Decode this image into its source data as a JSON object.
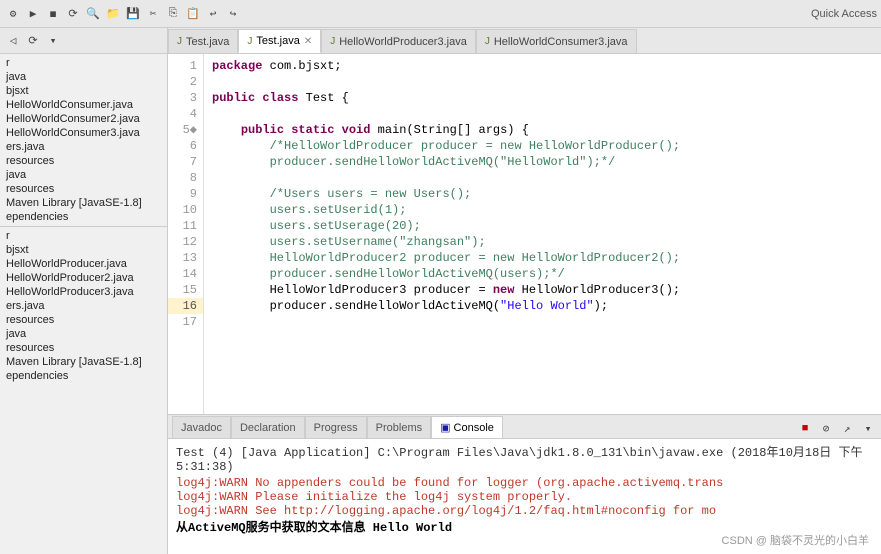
{
  "toolbar": {
    "quick_access_label": "Quick Access"
  },
  "sidebar": {
    "items": [
      {
        "label": "r"
      },
      {
        "label": "java"
      },
      {
        "label": "bjsxt"
      },
      {
        "label": "HelloWorldConsumer.java"
      },
      {
        "label": "HelloWorldConsumer2.java"
      },
      {
        "label": "HelloWorldConsumer3.java"
      },
      {
        "label": "ers.java"
      },
      {
        "label": "resources"
      },
      {
        "label": "java"
      },
      {
        "label": "resources"
      },
      {
        "label": "Maven Library [JavaSE-1.8]"
      },
      {
        "label": "ependencies"
      },
      {
        "label": ""
      },
      {
        "label": "r"
      },
      {
        "label": "bjsxt"
      },
      {
        "label": "HelloWorldProducer.java"
      },
      {
        "label": "HelloWorldProducer2.java"
      },
      {
        "label": "HelloWorldProducer3.java"
      },
      {
        "label": "ers.java"
      },
      {
        "label": "resources"
      },
      {
        "label": "java"
      },
      {
        "label": "resources"
      },
      {
        "label": "Maven Library [JavaSE-1.8]"
      },
      {
        "label": "ependencies"
      }
    ]
  },
  "tabs": [
    {
      "label": "Test.java",
      "icon": "J",
      "active": false,
      "show_close": false
    },
    {
      "label": "Test.java",
      "icon": "J",
      "active": true,
      "show_close": true
    },
    {
      "label": "HelloWorldProducer3.java",
      "icon": "J",
      "active": false,
      "show_close": false
    },
    {
      "label": "HelloWorldConsumer3.java",
      "icon": "J",
      "active": false,
      "show_close": false
    }
  ],
  "code": {
    "lines": [
      {
        "num": 1,
        "text": "package com.bjsxt;",
        "highlighted": false
      },
      {
        "num": 2,
        "text": "",
        "highlighted": false
      },
      {
        "num": 3,
        "text": "public class Test {",
        "highlighted": false
      },
      {
        "num": 4,
        "text": "",
        "highlighted": false
      },
      {
        "num": 5,
        "text": "    public static void main(String[] args) {",
        "highlighted": false
      },
      {
        "num": 6,
        "text": "        /*HelloWorldProducer producer = new HelloWorldProducer();",
        "highlighted": false
      },
      {
        "num": 7,
        "text": "        producer.sendHelloWorldActiveMQ(\"HelloWorld\");*/",
        "highlighted": false
      },
      {
        "num": 8,
        "text": "",
        "highlighted": false
      },
      {
        "num": 9,
        "text": "        /*Users users = new Users();",
        "highlighted": false
      },
      {
        "num": 10,
        "text": "        users.setUserid(1);",
        "highlighted": false
      },
      {
        "num": 11,
        "text": "        users.setUserage(20);",
        "highlighted": false
      },
      {
        "num": 12,
        "text": "        users.setUsername(\"zhangsan\");",
        "highlighted": false
      },
      {
        "num": 13,
        "text": "        HelloWorldProducer2 producer = new HelloWorldProducer2();",
        "highlighted": false
      },
      {
        "num": 14,
        "text": "        producer.sendHelloWorldActiveMQ(users);*/",
        "highlighted": false
      },
      {
        "num": 15,
        "text": "        HelloWorldProducer3 producer = new HelloWorldProducer3();",
        "highlighted": false
      },
      {
        "num": 16,
        "text": "        producer.sendHelloWorldActiveMQ(\"Hello World\");",
        "highlighted": true
      },
      {
        "num": 17,
        "text": "",
        "highlighted": false
      }
    ]
  },
  "bottom_tabs": [
    {
      "label": "Javadoc",
      "active": false
    },
    {
      "label": "Declaration",
      "active": false
    },
    {
      "label": "Progress",
      "active": false
    },
    {
      "label": "Problems",
      "active": false
    },
    {
      "label": "Console",
      "active": true,
      "icon": "console"
    }
  ],
  "console": {
    "header": "Test (4) [Java Application] C:\\Program Files\\Java\\jdk1.8.0_131\\bin\\javaw.exe (2018年10月18日 下午5:31:38)",
    "lines": [
      {
        "text": "log4j:WARN No appenders could be found for logger (org.apache.activemq.trans",
        "type": "warn"
      },
      {
        "text": "log4j:WARN Please initialize the log4j system properly.",
        "type": "warn"
      },
      {
        "text": "log4j:WARN See http://logging.apache.org/log4j/1.2/faq.html#noconfig for mo",
        "type": "warn"
      },
      {
        "text": "从ActiveMQ服务中获取的文本信息 Hello World",
        "type": "output",
        "bold_prefix": "从ActiveMQ服务中获取的文本信息 "
      }
    ]
  },
  "watermark": {
    "text": "CSDN @ 脑袋不灵光的小白羊"
  }
}
